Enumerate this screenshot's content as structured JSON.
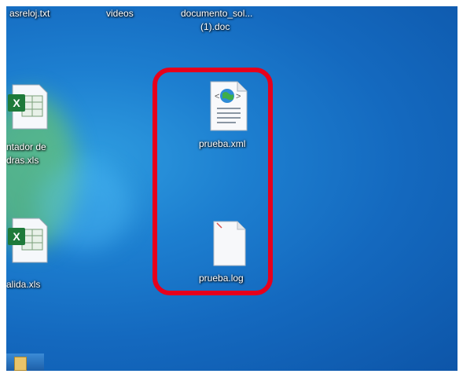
{
  "desktop": {
    "top_labels": [
      "asreloj.txt",
      "videos",
      "documento_sol...",
      "(1).doc"
    ],
    "left_icons": [
      {
        "label_line1": "ntador de",
        "label_line2": "dras.xls",
        "icon": "excel-file-icon"
      },
      {
        "label_line1": "alida.xls",
        "icon": "excel-file-icon"
      }
    ],
    "highlighted_files": [
      {
        "label": "prueba.xml",
        "icon": "xml-file-icon"
      },
      {
        "label": "prueba.log",
        "icon": "text-file-icon"
      }
    ],
    "highlight_color": "#e6001c",
    "taskbar_icon": "folder-icon"
  }
}
